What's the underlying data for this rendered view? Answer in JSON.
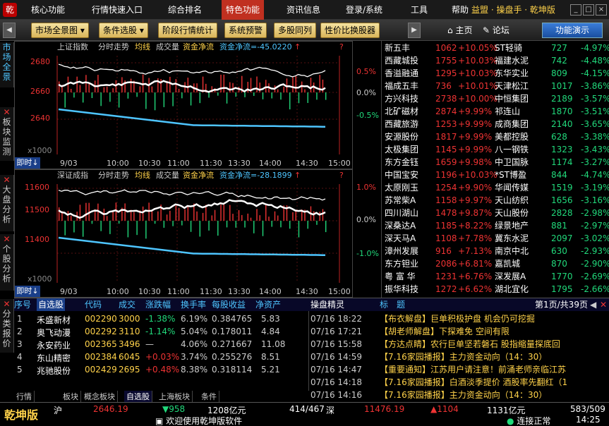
{
  "menu": {
    "items": [
      "核心功能",
      "行情快速入口",
      "综合排名",
      "特色功能",
      "资讯信息",
      "登录/系统",
      "工具",
      "帮助"
    ],
    "brand": "益盟 · 操盘手 · 乾坤版"
  },
  "toolbar": {
    "buttons": [
      "市场全景图",
      "条件选股",
      "阶段行情统计",
      "系统预警",
      "多股同列",
      "性价比换股器"
    ],
    "homepage": "主页",
    "forum": "论坛",
    "demo": "功能演示"
  },
  "left_tabs": [
    "市场全景",
    "板块监测",
    "大盘分析",
    "个股分析",
    "分类报价"
  ],
  "chart1": {
    "title": "上证指数",
    "subtitle": "分时走势",
    "ma": "均线",
    "vol": "成交量",
    "flow_label": "资金净流",
    "flow_value": "资金净流=-45.0220",
    "yl": [
      "2680",
      "2660",
      "2640"
    ],
    "yr": [
      "0.5%",
      "0.0%",
      "-0.5%"
    ],
    "vol_mult": "x1000",
    "xlabels": [
      "9/03",
      "10:00",
      "10:30",
      "11:00",
      "11:30",
      "13:30",
      "14:00",
      "14:30",
      "15:00"
    ],
    "fenshi": "即时"
  },
  "chart2": {
    "title": "深证成指",
    "subtitle": "分时走势",
    "ma": "均线",
    "vol": "成交量",
    "flow_label": "资金净流",
    "flow_value": "资金净流=-28.1899",
    "yl": [
      "11600",
      "11500",
      "11400"
    ],
    "yr": [
      "1.0%",
      "0.0%",
      "-1.0%"
    ],
    "vol_mult": "x1000",
    "xlabels": [
      "9/03",
      "10:00",
      "10:30",
      "11:00",
      "11:30",
      "13:30",
      "14:00",
      "14:30",
      "15:00"
    ],
    "fenshi": "即时"
  },
  "gainers": [
    [
      "新五丰",
      "1062",
      "+10.05%"
    ],
    [
      "西藏城投",
      "1755",
      "+10.03%"
    ],
    [
      "香溢融通",
      "1295",
      "+10.03%"
    ],
    [
      "福成五丰",
      "736",
      "+10.01%"
    ],
    [
      "方兴科技",
      "2738",
      "+10.00%"
    ],
    [
      "北矿磁材",
      "2874",
      "+9.99%"
    ],
    [
      "西藏旅游",
      "1253",
      "+9.99%"
    ],
    [
      "安源股份",
      "1817",
      "+9.99%"
    ],
    [
      "太极集团",
      "1145",
      "+9.99%"
    ],
    [
      "东方金钰",
      "1659",
      "+9.98%"
    ],
    [
      "中国宝安",
      "1196",
      "+10.03%"
    ],
    [
      "太原刚玉",
      "1254",
      "+9.90%"
    ],
    [
      "苏常柴A",
      "1158",
      "+9.97%"
    ],
    [
      "四川湖山",
      "1478",
      "+9.87%"
    ],
    [
      "深桑达A",
      "1185",
      "+8.22%"
    ],
    [
      "深天马A",
      "1108",
      "+7.78%"
    ],
    [
      "漳州发展",
      "916",
      "+7.13%"
    ],
    [
      "东方钽业",
      "2086",
      "+6.81%"
    ],
    [
      "粤 富 华",
      "1231",
      "+6.76%"
    ],
    [
      "振华科技",
      "1272",
      "+6.62%"
    ]
  ],
  "losers": [
    [
      "ST轻骑",
      "727",
      "-4.97%"
    ],
    [
      "福建水泥",
      "742",
      "-4.48%"
    ],
    [
      "东华实业",
      "809",
      "-4.15%"
    ],
    [
      "天津松江",
      "1017",
      "-3.86%"
    ],
    [
      "中恒集团",
      "2189",
      "-3.57%"
    ],
    [
      "祁连山",
      "1870",
      "-3.51%"
    ],
    [
      "成商集团",
      "2140",
      "-3.65%"
    ],
    [
      "美都控股",
      "628",
      "-3.38%"
    ],
    [
      "八一钢铁",
      "1323",
      "-3.43%"
    ],
    [
      "中卫国脉",
      "1174",
      "-3.27%"
    ],
    [
      "*ST博盈",
      "844",
      "-4.74%"
    ],
    [
      "华闻传媒",
      "1519",
      "-3.19%"
    ],
    [
      "天山纺织",
      "1656",
      "-3.16%"
    ],
    [
      "天山股份",
      "2828",
      "-2.98%"
    ],
    [
      "绿景地产",
      "881",
      "-2.97%"
    ],
    [
      "冀东水泥",
      "2097",
      "-3.02%"
    ],
    [
      "南京中北",
      "630",
      "-2.93%"
    ],
    [
      "嘉凯城",
      "870",
      "-2.90%"
    ],
    [
      "深发展A",
      "1770",
      "-2.69%"
    ],
    [
      "湖北宜化",
      "1795",
      "-2.66%"
    ]
  ],
  "watch": {
    "headers": [
      "序号",
      "自选股",
      "代码",
      "成交",
      "涨跌幅",
      "换手率",
      "每股收益",
      "净资产"
    ],
    "rows": [
      [
        "1",
        "禾盛新材",
        "002290",
        "3000",
        "-1.38%",
        "6.19%",
        "0.384765",
        "5.83"
      ],
      [
        "2",
        "奥飞动漫",
        "002292",
        "3110",
        "-1.14%",
        "5.04%",
        "0.178011",
        "4.84"
      ],
      [
        "3",
        "永安药业",
        "002365",
        "3496",
        "—",
        "4.06%",
        "0.271667",
        "11.08"
      ],
      [
        "4",
        "东山精密",
        "002384",
        "6045",
        "+0.03%",
        "3.74%",
        "0.255276",
        "8.51"
      ],
      [
        "5",
        "兆驰股份",
        "002429",
        "2695",
        "+0.48%",
        "8.38%",
        "0.318114",
        "5.21"
      ]
    ]
  },
  "news": {
    "title": "操盘精灵",
    "col": "标　题",
    "page": "第1页/共39页",
    "rows": [
      [
        "07/16 18:22",
        "【布衣解盘】巨单积极护盘 机会仍可挖掘"
      ],
      [
        "07/16 17:21",
        "【胡老师解盘】下探难免 空间有限"
      ],
      [
        "07/16 15:58",
        "【方达点睛】农行巨单坚若磐石 股指缩量探底回"
      ],
      [
        "07/16 14:59",
        "【7.16家园播报】主力资金动向（14：30）"
      ],
      [
        "07/16 14:47",
        "【重要通知】江苏用户请注意！前涌老师亲临江苏"
      ],
      [
        "07/16 14:18",
        "【7.16家园播报】白酒淡季提价 酒股率先翻红（1"
      ],
      [
        "07/16 14:16",
        "【7.16家园播报】主力资金动向（14：30）"
      ]
    ]
  },
  "bottom_tabs": [
    "行情",
    "板块",
    "概念板块",
    "自选股",
    "上海板块",
    "条件"
  ],
  "status": {
    "logo": "乾坤版",
    "sh_label": "沪",
    "sh_index": "2646.19",
    "sh_chg": "▼958",
    "sh_amt": "1208亿元",
    "sh_ud": "414/467",
    "sz_label": "深",
    "sz_index": "11476.19",
    "sz_chg": "▲1104",
    "sz_amt": "1131亿元",
    "sz_ud": "583/509",
    "welcome": "欢迎使用乾坤版软件",
    "conn": "连接正常",
    "time": "14:25"
  },
  "colors": {
    "up": "#ff3b3b",
    "down": "#21d97b",
    "hilite": "#ffd24a",
    "cyan": "#4ec5ff"
  }
}
